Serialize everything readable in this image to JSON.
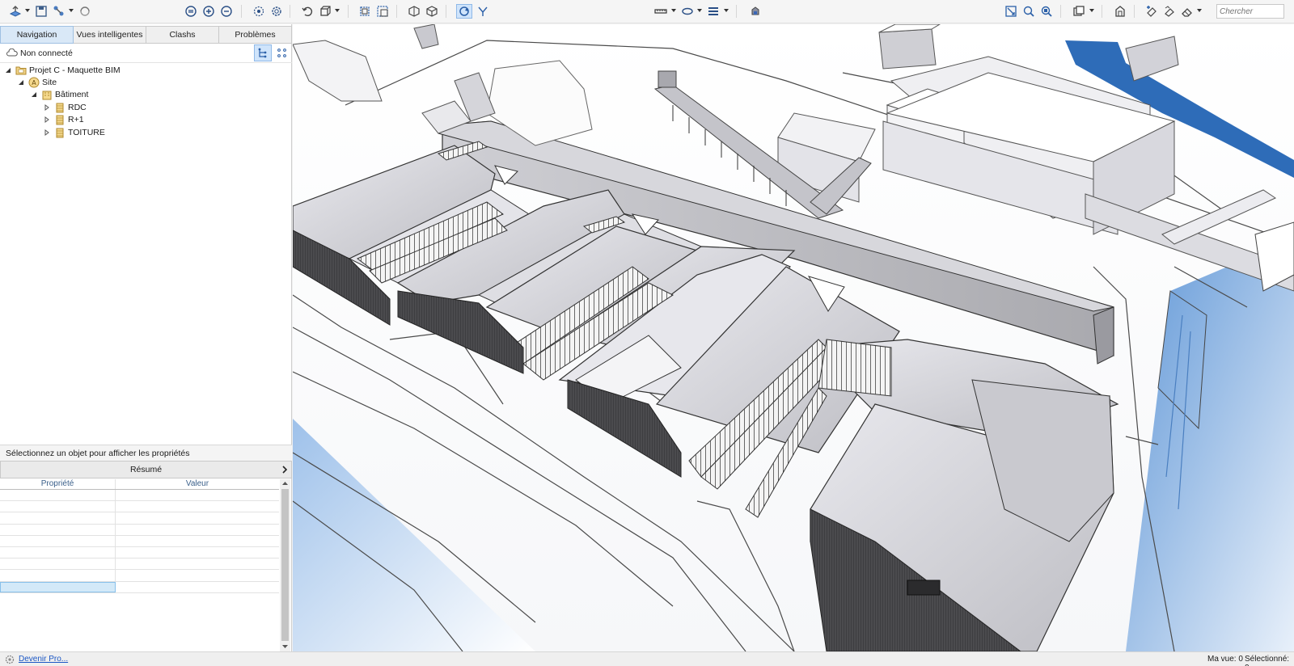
{
  "colors": {
    "accent": "#2f6fc0",
    "selection": "#cfe4fb",
    "water": "#3a78c4"
  },
  "toolbar": {
    "search_placeholder": "Chercher",
    "icons": [
      "open-file-icon",
      "save-icon",
      "share-icon",
      "sync-icon",
      "fit-all-icon",
      "zoom-in-icon",
      "zoom-out-icon",
      "orbit-icon",
      "settings-view-icon",
      "undo-icon",
      "view-cube-icon",
      "select-box-icon",
      "select-window-icon",
      "section-box-icon",
      "cube-icon",
      "navigate-icon",
      "walk-icon",
      "measure-icon",
      "markup-icon",
      "lineweight-icon",
      "render-icon",
      "zoom-extents-icon",
      "zoom-window-icon",
      "zoom-selected-icon",
      "layers-icon",
      "home-icon",
      "add-tag-icon",
      "markup-cloud-icon",
      "eraser-icon"
    ]
  },
  "left_panel": {
    "tabs": [
      "Navigation",
      "Vues intelligentes",
      "Clashs",
      "Problèmes"
    ],
    "connection_status": "Non connecté",
    "tree": [
      {
        "label": "Projet C - Maquette BIM",
        "level": 0,
        "icon": "project-folder-icon"
      },
      {
        "label": "Site",
        "level": 1,
        "icon": "site-icon"
      },
      {
        "label": "Bâtiment",
        "level": 2,
        "icon": "building-icon"
      },
      {
        "label": "RDC",
        "level": 3,
        "icon": "storey-icon"
      },
      {
        "label": "R+1",
        "level": 3,
        "icon": "storey-icon"
      },
      {
        "label": "TOITURE",
        "level": 3,
        "icon": "storey-icon"
      }
    ],
    "properties": {
      "header": "Sélectionnez un objet pour afficher les propriétés",
      "summary_label": "Résumé",
      "col_property": "Propriété",
      "col_value": "Valeur"
    }
  },
  "statusbar": {
    "pro_link": "Devenir Pro...",
    "view_count": "Ma vue: 0",
    "selected_count": "Sélectionné: 0"
  }
}
